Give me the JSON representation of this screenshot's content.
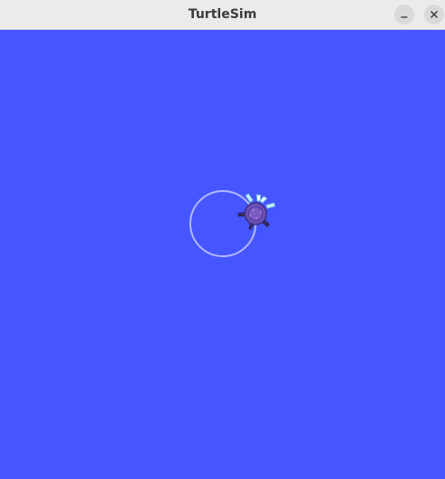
{
  "window": {
    "title": "TurtleSim"
  },
  "controls": {
    "minimize_icon": "minimize-icon",
    "close_icon": "close-icon"
  },
  "canvas": {
    "background_color": "#4556ff",
    "pen_color": "#b3b8ff",
    "turtle_icon": "turtle-icon"
  }
}
